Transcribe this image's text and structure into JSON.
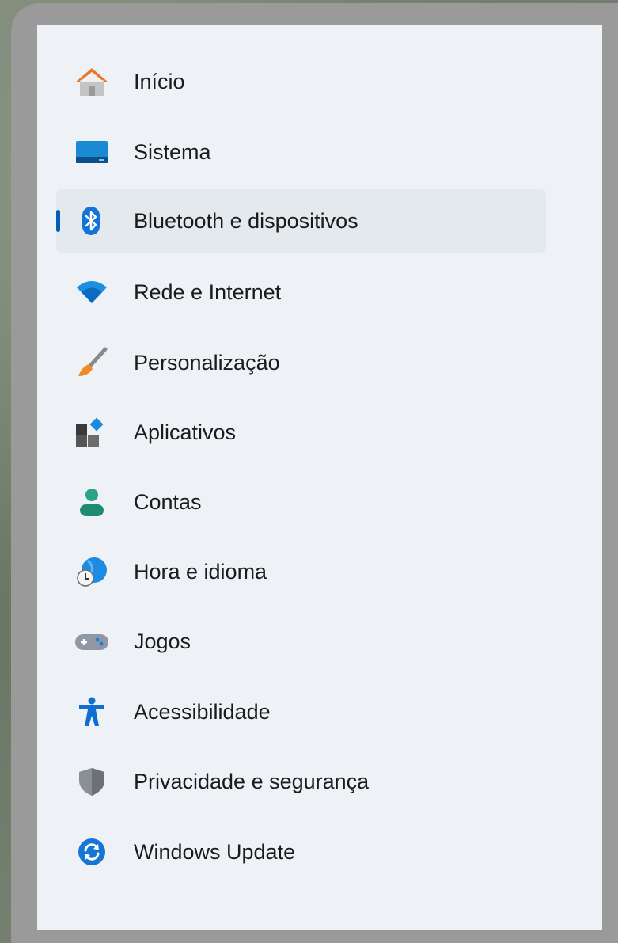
{
  "sidebar": {
    "selected_index": 2,
    "accent_color": "#005fb8",
    "items": [
      {
        "label": "Início",
        "icon": "home-icon"
      },
      {
        "label": "Sistema",
        "icon": "system-icon"
      },
      {
        "label": "Bluetooth e dispositivos",
        "icon": "bluetooth-icon"
      },
      {
        "label": "Rede e Internet",
        "icon": "wifi-icon"
      },
      {
        "label": "Personalização",
        "icon": "paintbrush-icon"
      },
      {
        "label": "Aplicativos",
        "icon": "apps-icon"
      },
      {
        "label": "Contas",
        "icon": "user-icon"
      },
      {
        "label": "Hora e idioma",
        "icon": "globe-clock-icon"
      },
      {
        "label": "Jogos",
        "icon": "gamepad-icon"
      },
      {
        "label": "Acessibilidade",
        "icon": "accessibility-icon"
      },
      {
        "label": "Privacidade e segurança",
        "icon": "shield-icon"
      },
      {
        "label": "Windows Update",
        "icon": "update-icon"
      }
    ]
  }
}
